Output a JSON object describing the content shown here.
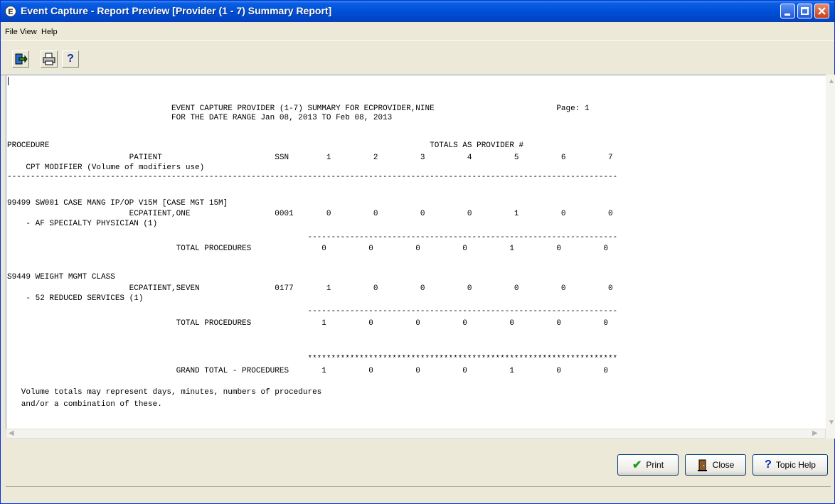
{
  "window": {
    "title": "Event Capture - Report Preview [Provider (1 - 7) Summary Report]",
    "title_icon_glyph": "E"
  },
  "menu": [
    "File",
    "View",
    "Help"
  ],
  "toolbar": {
    "exit_icon": "exit-icon",
    "print_icon": "printer-icon",
    "help_glyph": "?"
  },
  "report": {
    "lines": [
      "                                   EVENT CAPTURE PROVIDER (1-7) SUMMARY FOR ECPROVIDER,NINE                          Page: 1",
      "                                   FOR THE DATE RANGE Jan 08, 2013 TO Feb 08, 2013",
      "",
      "PROCEDURE                                                                                 TOTALS AS PROVIDER #",
      "                          PATIENT                        SSN        1         2         3         4         5         6         7",
      "    CPT MODIFIER (Volume of modifiers use)",
      "----------------------------------------------------------------------------------------------------------------------------------",
      "",
      "99499 SW001 CASE MANG IP/OP V15M [CASE MGT 15M]",
      "                          ECPATIENT,ONE                  0001       0         0         0         0         1         0         0",
      "    - AF SPECIALTY PHYSICIAN (1)",
      "                                                                ------------------------------------------------------------------",
      "                                    TOTAL PROCEDURES               0         0         0         0         1         0         0",
      "",
      "S9449 WEIGHT MGMT CLASS",
      "                          ECPATIENT,SEVEN                0177       1         0         0         0         0         0         0",
      "    - 52 REDUCED SERVICES (1)",
      "                                                                ------------------------------------------------------------------",
      "                                    TOTAL PROCEDURES               1         0         0         0         0         0         0",
      "",
      "",
      "                                                                ******************************************************************",
      "                                    GRAND TOTAL - PROCEDURES       1         0         0         0         1         0         0",
      "",
      "   Volume totals may represent days, minutes, numbers of procedures",
      "   and/or a combination of these."
    ]
  },
  "buttons": {
    "print": "Print",
    "close": "Close",
    "topic_help": "Topic Help"
  },
  "colors": {
    "titlebar": "#0050d8",
    "window_bg": "#ece9d8",
    "print_check": "#1e9a1e",
    "help_icon": "#0a2aa8"
  }
}
